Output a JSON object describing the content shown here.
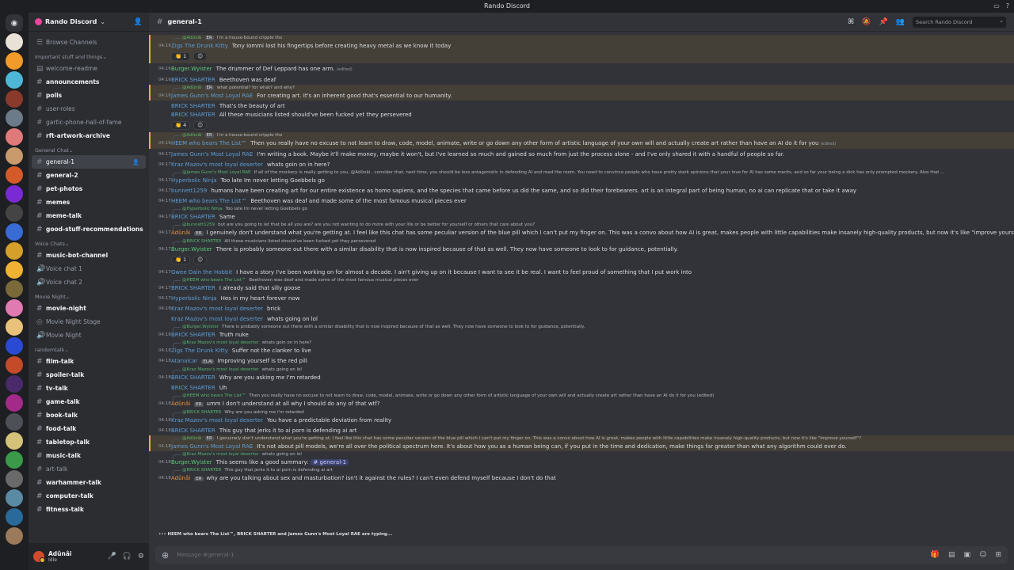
{
  "window": {
    "title": "Rando Discord"
  },
  "colors": {
    "accent": "#5865f2",
    "mention_bg": "#f0b232",
    "server_icon": "#eb459e"
  },
  "guilds": [
    {
      "color": "#e8e1d6"
    },
    {
      "color": "#f29b2a"
    },
    {
      "color": "#4fb7d6"
    },
    {
      "color": "#8a3a2a"
    },
    {
      "color": "#6b7b8a"
    },
    {
      "color": "#e07a7a"
    },
    {
      "color": "#c99a6b"
    },
    {
      "color": "#d45a2a"
    },
    {
      "color": "#7a2ad4"
    },
    {
      "color": "#444444"
    },
    {
      "color": "#3a6ad4"
    },
    {
      "color": "#d4a02a"
    },
    {
      "color": "#f0b232"
    },
    {
      "color": "#7a6a3a"
    },
    {
      "color": "#e07ab0"
    },
    {
      "color": "#e8c27a"
    },
    {
      "color": "#2a4ad4"
    },
    {
      "color": "#c44a2a"
    },
    {
      "color": "#4a2a6a"
    },
    {
      "color": "#a42a8a"
    },
    {
      "color": "#4e5058"
    },
    {
      "color": "#d4c27a"
    },
    {
      "color": "#3a9a4a"
    },
    {
      "color": "#6a6a6a"
    },
    {
      "color": "#5a8aa4"
    },
    {
      "color": "#2a6a9a"
    },
    {
      "color": "#9a7a5a"
    }
  ],
  "sidebar": {
    "server_name": "Rando Discord",
    "browse": "Browse Channels",
    "categories": [
      {
        "name": "Important stuff and things",
        "channels": [
          {
            "label": "welcome-readme",
            "icon": "book-icon",
            "state": "normal"
          },
          {
            "label": "announcements",
            "icon": "#",
            "state": "unread"
          },
          {
            "label": "polls",
            "icon": "#",
            "state": "unread"
          },
          {
            "label": "user-roles",
            "icon": "#",
            "state": "normal"
          },
          {
            "label": "gartic-phone-hall-of-fame",
            "icon": "#",
            "state": "normal"
          },
          {
            "label": "rft-artwork-archive",
            "icon": "#",
            "state": "unread"
          }
        ]
      },
      {
        "name": "General Chat",
        "channels": [
          {
            "label": "general-1",
            "icon": "#",
            "state": "active"
          },
          {
            "label": "general-2",
            "icon": "#",
            "state": "unread"
          },
          {
            "label": "pet-photos",
            "icon": "#",
            "state": "unread"
          },
          {
            "label": "memes",
            "icon": "#",
            "state": "unread"
          },
          {
            "label": "meme-talk",
            "icon": "#",
            "state": "unread"
          },
          {
            "label": "good-stuff-recommendations",
            "icon": "#",
            "state": "unread"
          }
        ]
      },
      {
        "name": "Voice Chats",
        "channels": [
          {
            "label": "music-bot-channel",
            "icon": "#",
            "state": "unread"
          },
          {
            "label": "Voice chat 1",
            "icon": "speaker",
            "state": "normal"
          },
          {
            "label": "Voice chat 2",
            "icon": "speaker",
            "state": "normal"
          }
        ]
      },
      {
        "name": "Movie Night",
        "channels": [
          {
            "label": "movie-night",
            "icon": "#",
            "state": "unread"
          },
          {
            "label": "Movie Night Stage",
            "icon": "stage",
            "state": "normal"
          },
          {
            "label": "Movie Night",
            "icon": "speaker",
            "state": "normal"
          }
        ]
      },
      {
        "name": "randomtalk",
        "channels": [
          {
            "label": "film-talk",
            "icon": "#",
            "state": "unread"
          },
          {
            "label": "spoiler-talk",
            "icon": "#",
            "state": "unread"
          },
          {
            "label": "tv-talk",
            "icon": "#",
            "state": "unread"
          },
          {
            "label": "game-talk",
            "icon": "#",
            "state": "unread"
          },
          {
            "label": "book-talk",
            "icon": "#",
            "state": "unread"
          },
          {
            "label": "food-talk",
            "icon": "#",
            "state": "unread"
          },
          {
            "label": "tabletop-talk",
            "icon": "#",
            "state": "unread"
          },
          {
            "label": "music-talk",
            "icon": "#",
            "state": "unread"
          },
          {
            "label": "art-talk",
            "icon": "#",
            "state": "normal"
          },
          {
            "label": "warhammer-talk",
            "icon": "#",
            "state": "unread"
          },
          {
            "label": "computer-talk",
            "icon": "#",
            "state": "unread"
          },
          {
            "label": "fitness-talk",
            "icon": "#",
            "state": "unread"
          }
        ]
      }
    ]
  },
  "user": {
    "name": "Adûnâi",
    "status": "Idle"
  },
  "channel": {
    "name": "general-1",
    "search_placeholder": "Search Rando Discord",
    "composer_placeholder": "Message #general-1"
  },
  "messages": [
    {
      "reply": {
        "user": "@Adûnâi",
        "tag": "ER",
        "text": "I'm a house-bound cripple tho"
      },
      "time": "04:16",
      "user": "Zigs The Drunk Kitty",
      "color": "blue",
      "text": "Tony Iommi lost his fingertips before creating heavy metal as we know it today",
      "mention": true,
      "reactions": [
        "👏 1",
        "☺"
      ]
    },
    {
      "time": "04:16",
      "user": "Burger.Wyister",
      "color": "green",
      "text": "The drummer of Def Leppard has one arm.",
      "edited": "(edited)"
    },
    {
      "time": "04:16",
      "user": "BRICK SHARTER",
      "color": "blue",
      "text": "Beethoven was deaf"
    },
    {
      "reply": {
        "user": "@Adûnâi",
        "tag": "ER",
        "text": "what potential? for what? and why?"
      },
      "time": "04:16",
      "user": "James Gunn's Most Loyal RAE",
      "color": "blue",
      "text": "For creating art. It's an inherent good that's essential to our humanity.",
      "mention": true
    },
    {
      "time": "",
      "user": "BRICK SHARTER",
      "color": "blue",
      "text": "That's the beauty of art"
    },
    {
      "time": "",
      "user": "BRICK SHARTER",
      "color": "blue",
      "text": "All these musicians listed should've been fucked yet they persevered",
      "reactions": [
        "👏 4",
        "☺"
      ]
    },
    {
      "reply": {
        "user": "@Adûnâi",
        "tag": "ER",
        "text": "I'm a house-bound cripple tho"
      },
      "time": "04:16",
      "user": "HEEM who bears The List™",
      "color": "blue",
      "text": "Then you really have no excuse to not learn to draw, code, model, animate, write or go down any other form of artistic language of your own will and actually create art rather than have an AI do it for you",
      "edited": "(edited)",
      "mention": true
    },
    {
      "time": "04:17",
      "user": "James Gunn's Most Loyal RAE",
      "color": "blue",
      "text": "I'm writing a book. Maybe it'll make money, maybe it won't, but I've learned so much and gained so much from just the process alone - and I've only shared it with a handful of people so far."
    },
    {
      "time": "04:17",
      "user": "Kraz Mazov's most loyal deserter",
      "color": "blue",
      "text": "whats goin on in here?"
    },
    {
      "reply": {
        "user": "@James Gunn's Most Loyal RAE",
        "tag": "",
        "text": "If all of the mockery is really getting to you, @Adûnâi , consider that, next time, you should be less antagonistic in defending AI and read the room. You need to convince people who have pretty stark opinions that your love for AI has some merits, and so far your being a dick has only prompted mockery.  Also that ..."
      },
      "time": "04:17",
      "user": "Hyperbolic Ninja",
      "color": "blue",
      "text": "Too late Im never letting Goebbels go"
    },
    {
      "time": "04:17",
      "user": "bunnett1259",
      "color": "blue",
      "text": "humans have been creating art for our entire existence as homo sapiens, and the species that came before us did the same, and so did their forebearers. art is an integral part of being human, no ai can replicate that or take it away"
    },
    {
      "time": "04:17",
      "user": "HEEM who bears The List™",
      "color": "blue",
      "text": "Beethoven was deaf and made some of the most famous musical pieces ever"
    },
    {
      "reply": {
        "user": "@Hyperbolic Ninja",
        "tag": "",
        "text": "Too late Im never letting Goebbels go"
      },
      "time": "04:17",
      "user": "BRICK SHARTER",
      "color": "blue",
      "text": "Same"
    },
    {
      "reply": {
        "user": "@bunnett1259",
        "tag": "",
        "text": "but are you going to let that be all you are? are you not wanting to do more with your life or be better for yourself or others that care about you?"
      },
      "time": "04:17",
      "user": "Adûnâi",
      "color": "orange",
      "tag": "ER",
      "text": "I genuinely don't understand what you're getting at. I feel like this chat has some peculiar version of the blue pill which I can't put my finger on. This was a convo about how AI is great, makes people with little capabilities make insanely high-quality products, but now it's like \"improve yourself\"?"
    },
    {
      "reply": {
        "user": "@BRICK SHARTER",
        "tag": "",
        "text": "All these musicians listed should've been fucked yet they persevered"
      },
      "time": "04:17",
      "user": "Burger.Wyister",
      "color": "green",
      "text": "There is probably someone out there with a similar disability that is now inspired because of that as well. They now have someone to look to for guidance, potentially.",
      "reactions": [
        "👏 1",
        "☺"
      ]
    },
    {
      "time": "04:17",
      "user": "Gwee Dain the Hobbit",
      "color": "blue",
      "text": "I have a story I've been working on for almost a decade. I ain't giving up on it because I want to see it be real. I want to feel proud of something that I put work into"
    },
    {
      "reply": {
        "user": "@HEEM who bears The List™",
        "tag": "",
        "text": "Beethoven was deaf and made some of the most famous musical pieces ever"
      },
      "time": "04:17",
      "user": "BRICK SHARTER",
      "color": "blue",
      "text": "I already said that silly goose"
    },
    {
      "time": "04:17",
      "user": "Hyperbolic Ninja",
      "color": "blue",
      "text": "Hes in my heart forever now"
    },
    {
      "time": "04:18",
      "user": "Kraz Mazov's most loyal deserter",
      "color": "blue",
      "text": "brick"
    },
    {
      "time": "",
      "user": "Kraz Mazov's most loyal deserter",
      "color": "blue",
      "text": "whats going on lol"
    },
    {
      "reply": {
        "user": "@Burger.Wyister",
        "tag": "",
        "text": "There is probably someone out there with a similar disability that is now inspired because of that as well. They now have someone to look to for guidance, potentially."
      },
      "time": "04:18",
      "user": "BRICK SHARTER",
      "color": "blue",
      "text": "Truth nuke"
    },
    {
      "reply": {
        "user": "@Kraz Mazov's most loyal deserter",
        "tag": "",
        "text": "whats goin on in here?"
      },
      "time": "04:18",
      "user": "Zigs The Drunk Kitty",
      "color": "blue",
      "text": "Suffer not the clanker to live"
    },
    {
      "time": "04:18",
      "user": "Atanalcar",
      "color": "blue",
      "tag": "ELAI",
      "text": "Improving yourself is the red pill"
    },
    {
      "reply": {
        "user": "@Kraz Mazov's most loyal deserter",
        "tag": "",
        "text": "whats going on lol"
      },
      "time": "04:18",
      "user": "BRICK SHARTER",
      "color": "blue",
      "text": "Why are you asking me I'm retarded"
    },
    {
      "time": "",
      "user": "BRICK SHARTER",
      "color": "blue",
      "text": "Uh"
    },
    {
      "reply": {
        "user": "@HEEM who bears The List™",
        "tag": "",
        "text": "Then you really have no excuse to not learn to draw, code, model, animate, write or go down any other form of artistic language of your own will and actually create art rather than have an AI do it for you (edited)"
      },
      "time": "04:18",
      "user": "Adûnâi",
      "color": "orange",
      "tag": "ER",
      "text": "umm I don't understand at all why I should do any of that wtf?"
    },
    {
      "reply": {
        "user": "@BRICK SHARTER",
        "tag": "",
        "text": "Why are you asking me I'm retarded"
      },
      "time": "04:18",
      "user": "Kraz Mazov's most loyal deserter",
      "color": "blue",
      "text": "You have a predictable deviation from reality"
    },
    {
      "time": "04:18",
      "user": "BRICK SHARTER",
      "color": "blue",
      "text": "This guy that jerks it to ai porn is defending ai art"
    },
    {
      "reply": {
        "user": "@Adûnâi",
        "tag": "ER",
        "text": "I genuinely don't understand what you're getting at. I feel like this chat has some peculiar version of the blue pill which I can't put my finger on. This was a convo about how AI is great, makes people with little capabilities make insanely high-quality products, but now it's like \"improve yourself\"?"
      },
      "time": "04:18",
      "user": "James Gunn's Most Loyal RAE",
      "color": "blue",
      "text": "It's not about pill models, we're all over the political spectrum here. It's about how you as a human being can, if you put in the time and dedication, make things far greater than what any algorithm could ever do.",
      "mention": true
    },
    {
      "reply": {
        "user": "@Kraz Mazov's most loyal deserter",
        "tag": "",
        "text": "whats going on lol"
      },
      "time": "04:18",
      "user": "Burger.Wyister",
      "color": "green",
      "text": "This seems like a good summary:",
      "chanref": "# general-1"
    },
    {
      "reply": {
        "user": "@BRICK SHARTER",
        "tag": "",
        "text": "This guy that jerks it to ai porn is defending ai art"
      },
      "time": "04:18",
      "user": "Adûnâi",
      "color": "orange",
      "tag": "ER",
      "text": "why are you talking about sex and masturbation? isn't it against the rules? I can't even defend myself because I don't do that"
    }
  ],
  "typing": "HEEM who bears The List™, BRICK SHARTER and James Gunn's Most Loyal RAE are typing..."
}
